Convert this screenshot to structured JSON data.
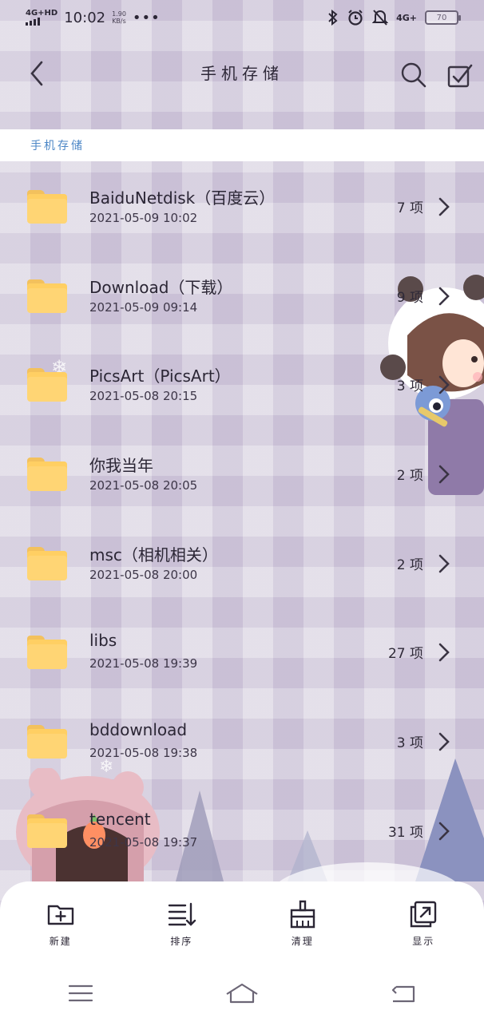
{
  "status": {
    "network": "4G+HD",
    "time": "10:02",
    "speed_value": "1.90",
    "speed_unit": "KB/s",
    "more": "•••",
    "net_right": "4G+",
    "battery": "70"
  },
  "header": {
    "title": "手机存储",
    "back_icon": "chevron-left-icon",
    "search_icon": "search-icon",
    "select_icon": "checkbox-icon"
  },
  "breadcrumb": "手机存储",
  "colors": {
    "folder": "#ffd574",
    "breadcrumb": "#4b86c6",
    "accent_bg": "#d6cfdf"
  },
  "files": [
    {
      "name": "BaiduNetdisk（百度云）",
      "date": "2021-05-09 10:02",
      "count": "7 项"
    },
    {
      "name": "Download（下载）",
      "date": "2021-05-09 09:14",
      "count": "9 项"
    },
    {
      "name": "PicsArt（PicsArt）",
      "date": "2021-05-08 20:15",
      "count": "3 项"
    },
    {
      "name": "你我当年",
      "date": "2021-05-08 20:05",
      "count": "2 项"
    },
    {
      "name": "msc（相机相关）",
      "date": "2021-05-08 20:00",
      "count": "2 项"
    },
    {
      "name": "libs",
      "date": "2021-05-08 19:39",
      "count": "27 项"
    },
    {
      "name": "bddownload",
      "date": "2021-05-08 19:38",
      "count": "3 项"
    },
    {
      "name": "tencent",
      "date": "2021-05-08 19:37",
      "count": "31 项"
    }
  ],
  "actions": [
    {
      "label": "新建",
      "icon": "new-folder-icon"
    },
    {
      "label": "排序",
      "icon": "sort-icon"
    },
    {
      "label": "清理",
      "icon": "broom-icon"
    },
    {
      "label": "显示",
      "icon": "display-icon"
    }
  ],
  "navbar": {
    "menu_icon": "menu-icon",
    "home_icon": "home-icon",
    "back_icon": "back-icon"
  }
}
